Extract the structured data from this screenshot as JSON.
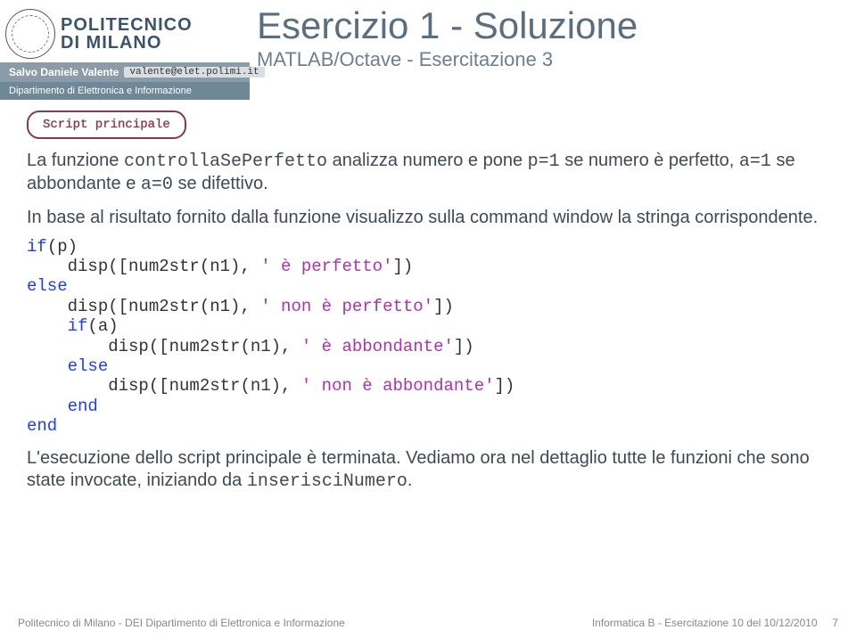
{
  "logo": {
    "top": "POLITECNICO",
    "bottom": "DI MILANO"
  },
  "author": {
    "name": "Salvo Daniele Valente",
    "email": "valente@elet.polimi.it"
  },
  "department": "Dipartimento di Elettronica e Informazione",
  "title": "Esercizio 1 - Soluzione",
  "subtitle": "MATLAB/Octave - Esercitazione 3",
  "box_label": "Script principale",
  "para1_a": "La funzione ",
  "para1_code1": "controllaSePerfetto",
  "para1_b": " analizza numero e pone ",
  "para1_code2": "p=1",
  "para1_c": " se numero è perfetto, ",
  "para1_code3": "a=1",
  "para1_d": " se abbondante e ",
  "para1_code4": "a=0",
  "para1_e": " se difettivo.",
  "para2": "In base al risultato fornito dalla funzione visualizzo sulla command window la stringa corrispondente.",
  "code": {
    "l1a": "if",
    "l1b": "(p)",
    "l2a": "    disp([num2str(n1), ",
    "l2b": "' è perfetto'",
    "l2c": "])",
    "l3": "else",
    "l4a": "    disp([num2str(n1), ",
    "l4b": "' non è perfetto'",
    "l4c": "])",
    "l5a": "    ",
    "l5b": "if",
    "l5c": "(a)",
    "l6a": "        disp([num2str(n1), ",
    "l6b": "' è abbondante'",
    "l6c": "])",
    "l7a": "    ",
    "l7b": "else",
    "l8a": "        disp([num2str(n1), ",
    "l8b": "' non è abbondante'",
    "l8c": "])",
    "l9a": "    ",
    "l9b": "end",
    "l10": "end"
  },
  "para3_a": "L'esecuzione dello script principale è terminata. Vediamo ora nel dettaglio tutte le funzioni che sono state invocate, iniziando da ",
  "para3_code": "inserisciNumero",
  "para3_b": ".",
  "footer_left": "Politecnico di Milano - DEI Dipartimento di Elettronica e Informazione",
  "footer_right": "Informatica B - Esercitazione 10 del 10/12/2010",
  "page_number": "7"
}
